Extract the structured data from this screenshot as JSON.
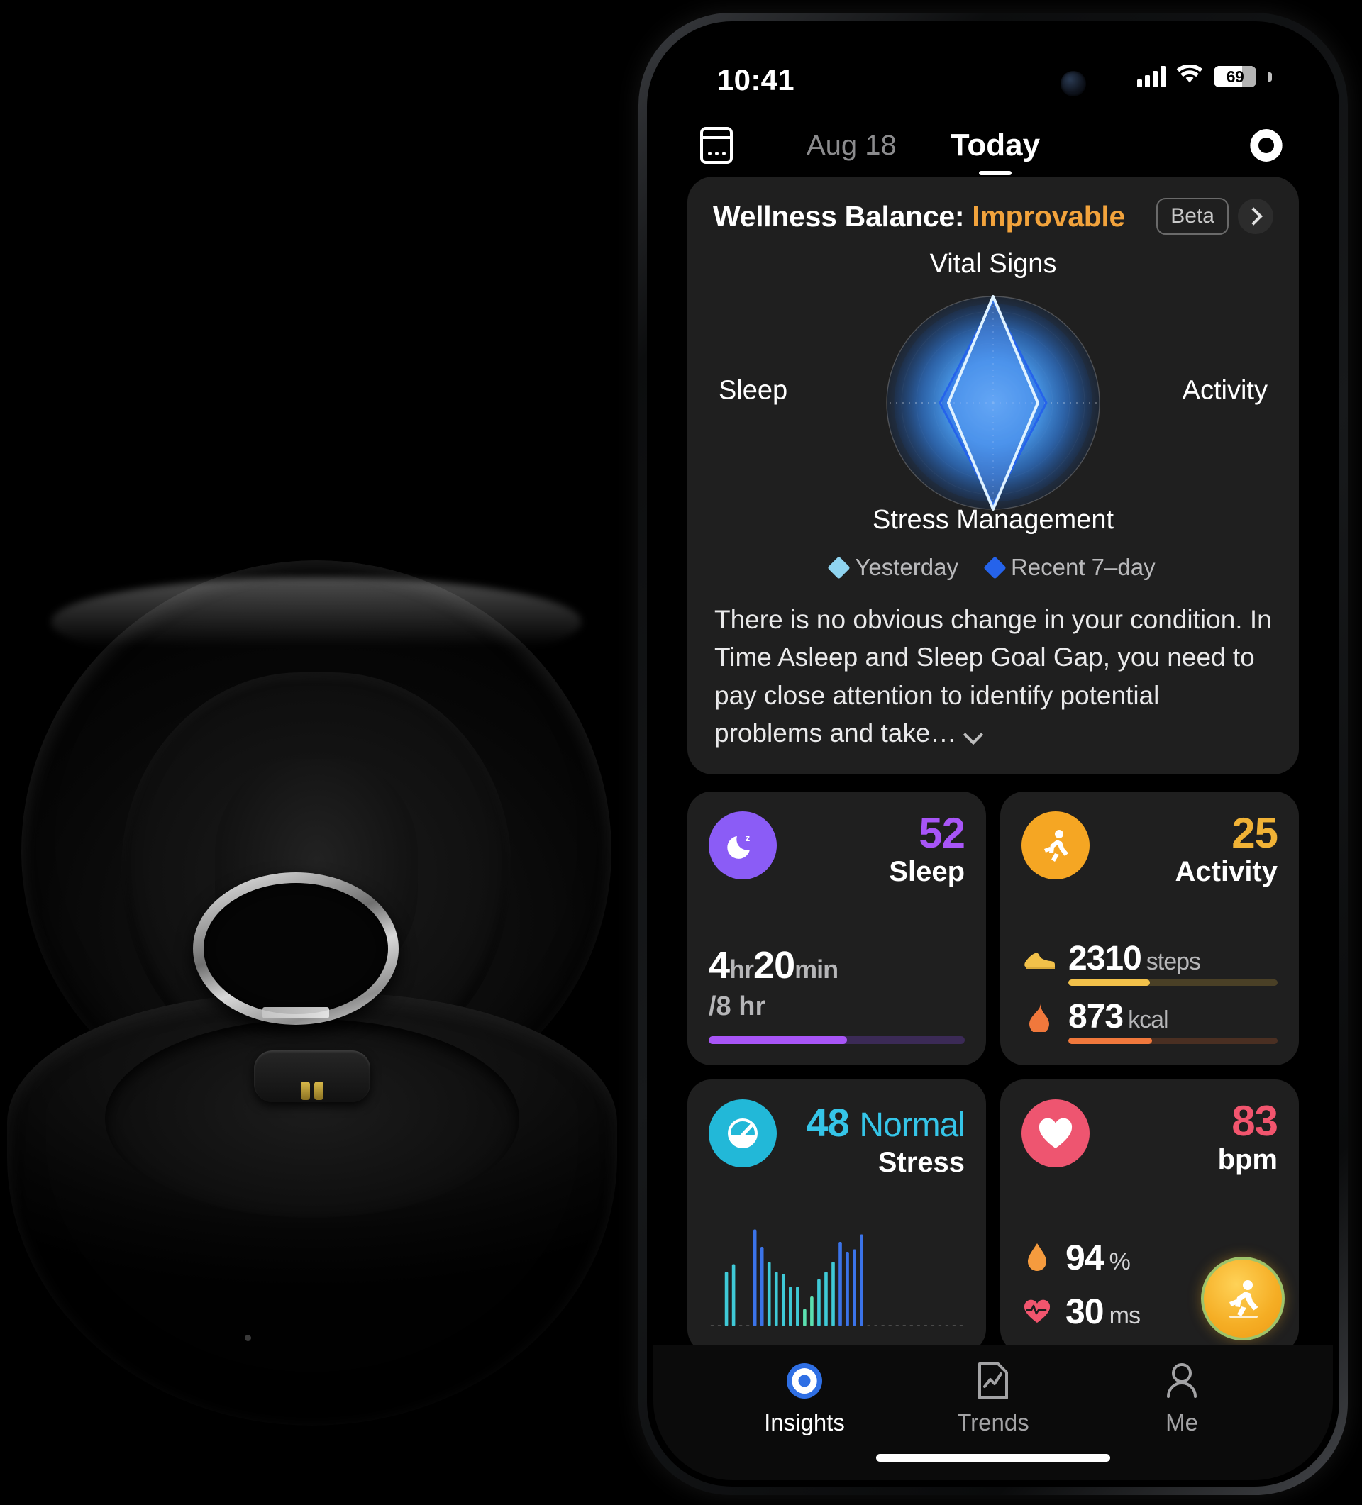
{
  "status_bar": {
    "time": "10:41",
    "battery_percent": "69",
    "signal_icon": "cellular-signal-icon",
    "wifi_icon": "wifi-icon",
    "battery_icon": "battery-icon"
  },
  "nav": {
    "calendar_icon": "calendar-icon",
    "prev_date": "Aug 18",
    "current_tab": "Today",
    "sync_icon": "sync-ring-icon"
  },
  "wellness": {
    "title_prefix": "Wellness Balance: ",
    "status": "Improvable",
    "status_color": "#F2A33C",
    "beta_label": "Beta",
    "chevron_icon": "chevron-right-icon",
    "legend": [
      {
        "label": "Yesterday",
        "color": "#8FD4F0"
      },
      {
        "label": "Recent 7–day",
        "color": "#2563EB"
      }
    ],
    "description": "There is no obvious change in your condition. In Time Asleep and Sleep Goal Gap, you need to pay close attention to identify potential problems and take…",
    "expand_icon": "chevron-down-icon"
  },
  "chart_data": {
    "type": "radar",
    "title": "Wellness Balance",
    "categories": [
      "Vital Signs",
      "Activity",
      "Stress Management",
      "Sleep"
    ],
    "axis_order": [
      "top",
      "right",
      "bottom",
      "left"
    ],
    "rmax": 100,
    "grid": "concentric-rings",
    "legend_position": "bottom",
    "series": [
      {
        "name": "Yesterday",
        "color": "#8FD4F0",
        "values": [
          100,
          42,
          100,
          42
        ]
      },
      {
        "name": "Recent 7–day",
        "color": "#2563EB",
        "values": [
          96,
          50,
          96,
          50
        ]
      }
    ]
  },
  "metrics": {
    "sleep": {
      "icon": "moon-sleep-icon",
      "icon_bg": "#8B5CF6",
      "score": "52",
      "score_color": "#A855F7",
      "name": "Sleep",
      "duration_hr": "4",
      "duration_hr_unit": "hr",
      "duration_min": "20",
      "duration_min_unit": "min",
      "goal": "/8 hr",
      "progress_percent": 54,
      "bar_color": "#A855F7",
      "bar_track": "#3b2a56"
    },
    "activity": {
      "icon": "running-person-icon",
      "icon_bg": "#F5A623",
      "score": "25",
      "score_color": "#F0B236",
      "name": "Activity",
      "rows": [
        {
          "icon": "sneaker-icon",
          "value": "2310",
          "unit": "steps",
          "progress_percent": 39,
          "bar_color": "#F2C14A",
          "bar_track": "#4a4026"
        },
        {
          "icon": "flame-icon",
          "value": "873",
          "unit": "kcal",
          "progress_percent": 40,
          "bar_color": "#F0783C",
          "bar_track": "#4a2f22"
        }
      ]
    },
    "stress": {
      "icon": "gauge-icon",
      "icon_bg": "#22B8D8",
      "score": "48",
      "level": "Normal",
      "score_color": "#35C5E8",
      "name": "Stress",
      "chart": {
        "type": "bar",
        "values": [
          0,
          0,
          44,
          50,
          0,
          0,
          78,
          64,
          52,
          44,
          42,
          32,
          32,
          14,
          24,
          38,
          44,
          52,
          68,
          60,
          62,
          74,
          0,
          0,
          0,
          0,
          0,
          0,
          0,
          0,
          0,
          0,
          0,
          0,
          0,
          0
        ],
        "colors_low": "#5BE0B0",
        "colors_mid": "#3FC9D6",
        "colors_high": "#3B73E8",
        "ymax": 80
      }
    },
    "heart": {
      "icon": "heart-icon",
      "icon_bg": "#EE5570",
      "score": "83",
      "score_color": "#F2556E",
      "name": "bpm",
      "rows": [
        {
          "icon": "blood-drop-icon",
          "value": "94",
          "unit": "%"
        },
        {
          "icon": "heart-pulse-icon",
          "value": "30",
          "unit": "ms"
        }
      ],
      "fab_icon": "workout-run-icon"
    }
  },
  "tabbar": {
    "items": [
      {
        "label": "Insights",
        "icon": "insights-ring-icon",
        "active": true
      },
      {
        "label": "Trends",
        "icon": "trends-chart-icon",
        "active": false
      },
      {
        "label": "Me",
        "icon": "person-icon",
        "active": false
      }
    ]
  }
}
